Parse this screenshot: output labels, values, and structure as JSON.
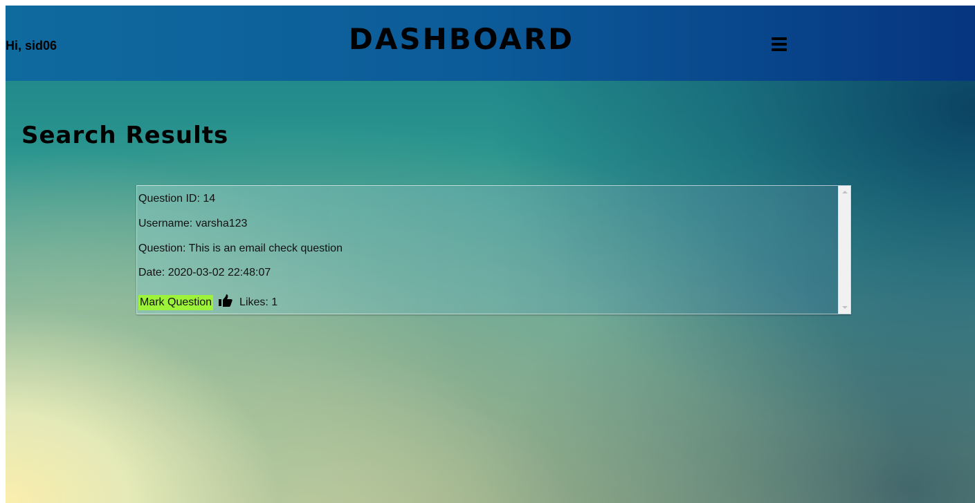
{
  "header": {
    "greeting": "Hi, sid06",
    "title": "DASHBOARD",
    "menu_icon": "hamburger-menu-icon"
  },
  "page": {
    "heading": "Search Results"
  },
  "result": {
    "question_id": "Question ID: 14",
    "username": "Username: varsha123",
    "question": "Question: This is an email check question",
    "date": "Date: 2020-03-02 22:48:07",
    "mark_label": "Mark Question",
    "like_icon": "thumbs-up-icon",
    "likes": "Likes: 1"
  },
  "colors": {
    "header_start": "#0f6a9e",
    "header_end": "#06357f",
    "mark_button": "#9cf33a"
  }
}
